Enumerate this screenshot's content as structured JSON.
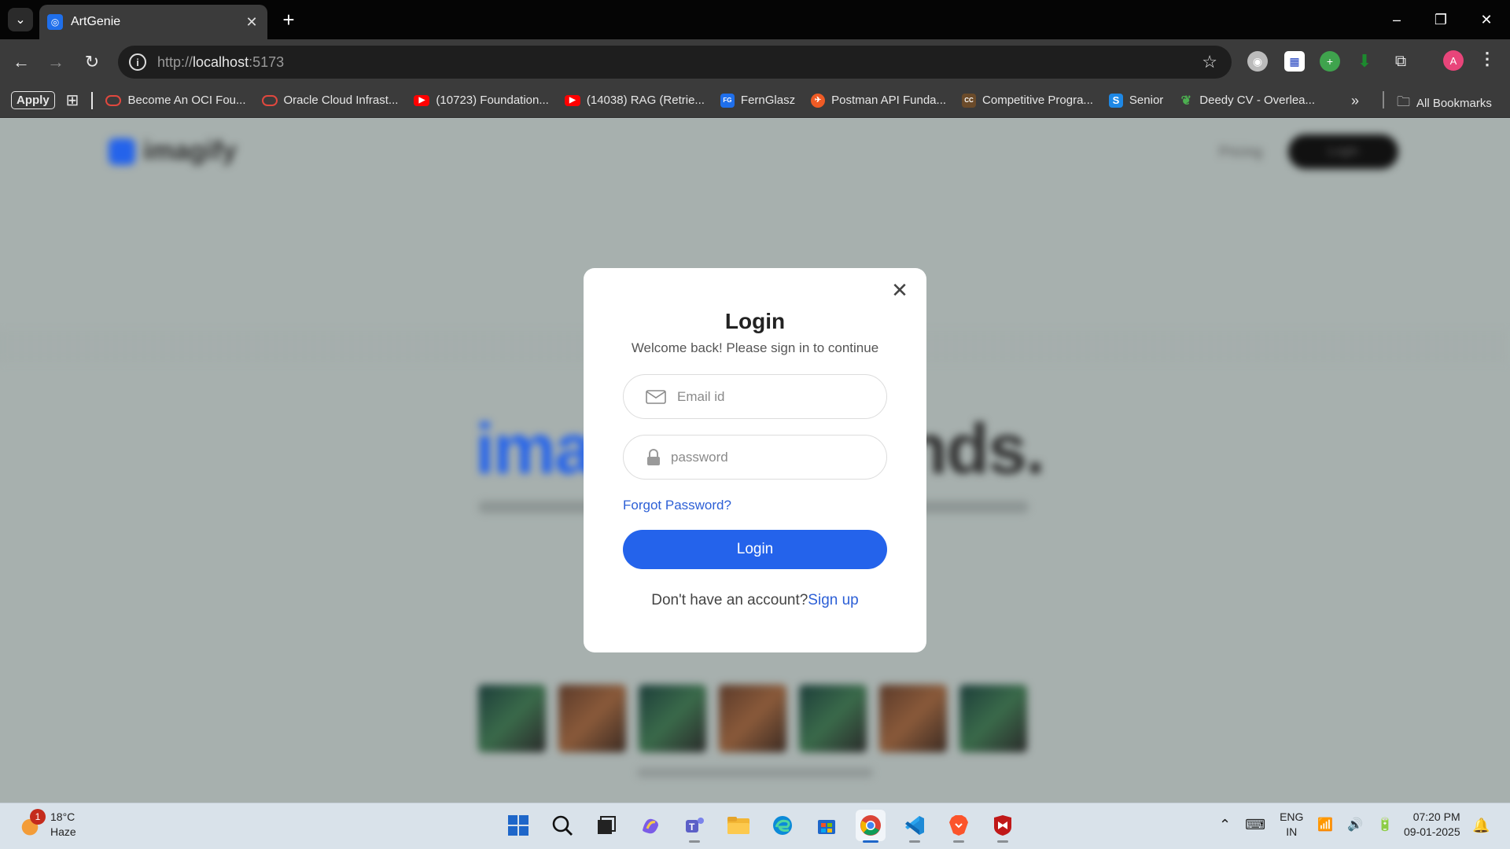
{
  "browser": {
    "tab": {
      "title": "ArtGenie",
      "close_icon": "close-icon"
    },
    "new_tab_label": "+",
    "window_controls": {
      "minimize": "–",
      "restore": "❐",
      "close": "✕"
    },
    "url": {
      "scheme": "http://",
      "host": "localhost",
      "port": ":5173"
    },
    "profile_initial": "A",
    "bookmarks": {
      "apply_label": "Apply",
      "items": [
        {
          "label": "Become An OCI Fou...",
          "icon": "oracle-icon",
          "color": "#e0483e"
        },
        {
          "label": "Oracle Cloud Infrast...",
          "icon": "oracle-icon",
          "color": "#e0483e"
        },
        {
          "label": "(10723) Foundation...",
          "icon": "youtube-icon",
          "color": "#ff0000"
        },
        {
          "label": "(14038) RAG (Retrie...",
          "icon": "youtube-icon",
          "color": "#ff0000"
        },
        {
          "label": "FernGlasz",
          "icon": "fernglasz-icon",
          "color": "#1f6feb",
          "abbr": "FG"
        },
        {
          "label": "Postman API Funda...",
          "icon": "postman-icon",
          "color": "#ef5b25"
        },
        {
          "label": "Competitive Progra...",
          "icon": "codechef-icon",
          "color": "#6b4b2a",
          "abbr": "CC"
        },
        {
          "label": "Senior",
          "icon": "s-icon",
          "color": "#1e88e5",
          "abbr": "S"
        },
        {
          "label": "Deedy CV - Overlea...",
          "icon": "overleaf-icon",
          "color": "#4caf50"
        }
      ],
      "all_bookmarks_label": "All Bookmarks"
    }
  },
  "background_page": {
    "logo_text": "imagify",
    "nav_pricing": "Pricing",
    "nav_login": "Login",
    "hero_left": "ima",
    "hero_right": "nds."
  },
  "login_modal": {
    "title": "Login",
    "subtitle": "Welcome back! Please sign in to continue",
    "email_placeholder": "Email id",
    "password_placeholder": "password",
    "forgot_password": "Forgot Password?",
    "submit_label": "Login",
    "signup_prompt": "Don't have an account?",
    "signup_link": "Sign up",
    "accent_color": "#2463eb"
  },
  "taskbar": {
    "weather": {
      "temp": "18°C",
      "condition": "Haze",
      "badge": "1"
    },
    "language": {
      "line1": "ENG",
      "line2": "IN"
    },
    "clock": {
      "time": "07:20 PM",
      "date": "09-01-2025"
    }
  }
}
